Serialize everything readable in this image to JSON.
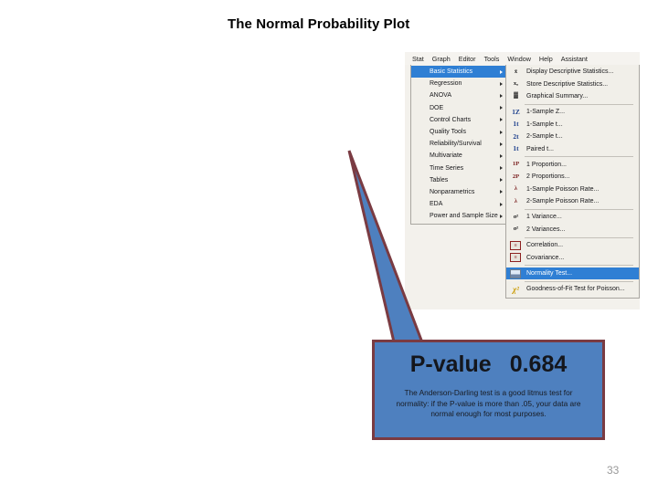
{
  "slide": {
    "title": "The Normal Probability Plot",
    "page_number": "33"
  },
  "minitab": {
    "menubar": [
      {
        "label": "Stat"
      },
      {
        "label": "Graph"
      },
      {
        "label": "Editor"
      },
      {
        "label": "Tools"
      },
      {
        "label": "Window"
      },
      {
        "label": "Help"
      },
      {
        "label": "Assistant"
      }
    ],
    "stat_menu": [
      {
        "label": "Basic Statistics",
        "selected": true
      },
      {
        "label": "Regression",
        "selected": false
      },
      {
        "label": "ANOVA",
        "selected": false
      },
      {
        "label": "DOE",
        "selected": false
      },
      {
        "label": "Control Charts",
        "selected": false
      },
      {
        "label": "Quality Tools",
        "selected": false
      },
      {
        "label": "Reliability/Survival",
        "selected": false
      },
      {
        "label": "Multivariate",
        "selected": false
      },
      {
        "label": "Time Series",
        "selected": false
      },
      {
        "label": "Tables",
        "selected": false
      },
      {
        "label": "Nonparametrics",
        "selected": false
      },
      {
        "label": "EDA",
        "selected": false
      },
      {
        "label": "Power and Sample Size",
        "selected": false
      }
    ],
    "basic_statistics_submenu": [
      {
        "label": "Display Descriptive Statistics...",
        "icon": "x-bar-icon",
        "glyph": "x̄",
        "style": "glyph-dark"
      },
      {
        "label": "Store Descriptive Statistics...",
        "icon": "store-stats-icon",
        "glyph": "xₐ",
        "style": "glyph-dark"
      },
      {
        "label": "Graphical Summary...",
        "icon": "graphical-summary-icon",
        "glyph": "▓",
        "style": "glyph-dark"
      },
      {
        "separator": true
      },
      {
        "label": "1-Sample Z...",
        "icon": "one-sample-z-icon",
        "glyph": "1Z",
        "style": "glyph-blue"
      },
      {
        "label": "1-Sample t...",
        "icon": "one-sample-t-icon",
        "glyph": "1t",
        "style": "glyph-blue"
      },
      {
        "label": "2-Sample t...",
        "icon": "two-sample-t-icon",
        "glyph": "2t",
        "style": "glyph-blue"
      },
      {
        "label": "Paired t...",
        "icon": "paired-t-icon",
        "glyph": "1t",
        "style": "glyph-blue"
      },
      {
        "separator": true
      },
      {
        "label": "1 Proportion...",
        "icon": "one-proportion-icon",
        "glyph": "1P",
        "style": ""
      },
      {
        "label": "2 Proportions...",
        "icon": "two-proportions-icon",
        "glyph": "2P",
        "style": ""
      },
      {
        "label": "1-Sample Poisson Rate...",
        "icon": "one-sample-poisson-icon",
        "glyph": "λ",
        "style": ""
      },
      {
        "label": "2-Sample Poisson Rate...",
        "icon": "two-sample-poisson-icon",
        "glyph": "λ",
        "style": ""
      },
      {
        "separator": true
      },
      {
        "label": "1 Variance...",
        "icon": "one-variance-icon",
        "glyph": "σ²",
        "style": "glyph-dark"
      },
      {
        "label": "2 Variances...",
        "icon": "two-variances-icon",
        "glyph": "σ²",
        "style": "glyph-dark"
      },
      {
        "separator": true
      },
      {
        "label": "Correlation...",
        "icon": "correlation-icon",
        "glyph": "≡",
        "style": "glyph-box"
      },
      {
        "label": "Covariance...",
        "icon": "covariance-icon",
        "glyph": "≡",
        "style": "glyph-box"
      },
      {
        "separator": true
      },
      {
        "label": "Normality Test...",
        "icon": "normality-test-icon",
        "glyph": "",
        "style": "glyph-nt",
        "selected": true
      },
      {
        "separator": true
      },
      {
        "label": "Goodness-of-Fit Test for Poisson...",
        "icon": "goodness-of-fit-icon",
        "glyph": "χ²",
        "style": "glyph-yellow"
      }
    ]
  },
  "callout": {
    "pvalue_label": "P-value",
    "pvalue_value": "0.684",
    "body": "The Anderson-Darling test is a good litmus test for normality: if the P-value is more than .05, your data are normal enough for most purposes.",
    "fill_color": "#4e80bf",
    "border_color": "#7a3b42"
  }
}
